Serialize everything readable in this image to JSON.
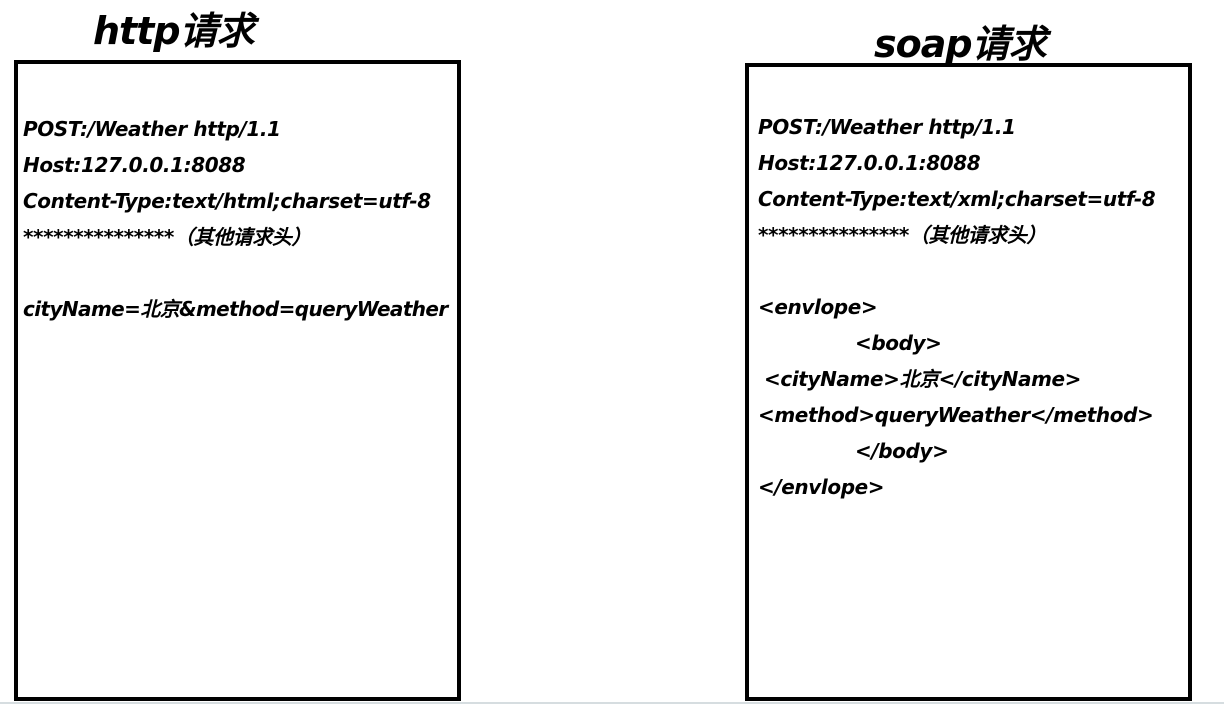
{
  "http": {
    "title": "http请求",
    "lines": [
      "POST:/Weather http/1.1",
      "Host:127.0.0.1:8088",
      "Content-Type:text/html;charset=utf-8",
      "***************（其他请求头）",
      "cityName=北京&method=queryWeather"
    ]
  },
  "soap": {
    "title": "soap请求",
    "lines": [
      "POST:/Weather http/1.1",
      "Host:127.0.0.1:8088",
      "Content-Type:text/xml;charset=utf-8",
      "***************（其他请求头）",
      "<envlope>",
      "<body>",
      "<cityName>北京</cityName>",
      "<method>queryWeather</method>",
      "</body>",
      "</envlope>"
    ]
  }
}
